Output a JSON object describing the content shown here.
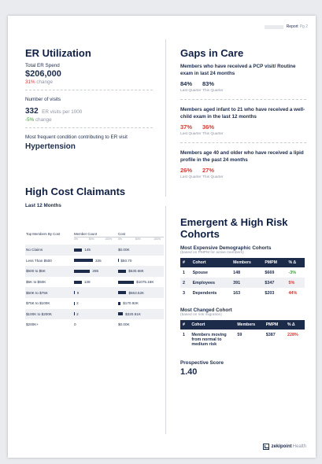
{
  "header": {
    "blurred": "",
    "report_label": "Report",
    "page_label": "Pg 2"
  },
  "er": {
    "title": "ER Utilization",
    "total_label": "Total ER Spend",
    "total_value": "$206,000",
    "total_change_value": "31%",
    "total_change_word": "change",
    "visits_label": "Number of visits",
    "visits_value": "332",
    "visits_unit": "ER visits per 1000",
    "visits_change_value": "-5%",
    "visits_change_word": "change",
    "condition_label": "Most frequent condition contributing to ER visit",
    "condition_value": "Hypertension"
  },
  "hc": {
    "title": "High Cost Claimants",
    "subtitle": "Last 12 Months",
    "col1": "Top Members By Cost",
    "col2": "Member Count",
    "col3": "Cost",
    "axis": [
      "0%",
      "50%",
      "100%"
    ],
    "rows": [
      {
        "label": "No Claims",
        "count": "145",
        "count_frac": 0.43,
        "cost": "$0.00K",
        "cost_frac": 0.0
      },
      {
        "label": "Less Than $500",
        "count": "335",
        "count_frac": 1.0,
        "cost": "$50.70",
        "cost_frac": 0.01
      },
      {
        "label": "$500 to $5K",
        "count": "285",
        "count_frac": 0.85,
        "cost": "$530.68K",
        "cost_frac": 0.28
      },
      {
        "label": "$5K to $50K",
        "count": "138",
        "count_frac": 0.41,
        "cost": "$1075.16K",
        "cost_frac": 0.56
      },
      {
        "label": "$50K to $75K",
        "count": "9",
        "count_frac": 0.03,
        "cost": "$553.52K",
        "cost_frac": 0.29
      },
      {
        "label": "$75K to $100K",
        "count": "2",
        "count_frac": 0.006,
        "cost": "$170.92K",
        "cost_frac": 0.09
      },
      {
        "label": "$100K to $200K",
        "count": "2",
        "count_frac": 0.006,
        "cost": "$320.91K",
        "cost_frac": 0.17
      },
      {
        "label": "$200K+",
        "count": "0",
        "count_frac": 0.0,
        "cost": "$0.00K",
        "cost_frac": 0.0
      }
    ]
  },
  "gaps": {
    "title": "Gaps in Care",
    "items": [
      {
        "text": "Members who have received a PCP visit/ Routine exam in last 24 months",
        "last": "84%",
        "this": "83%",
        "color": "#1d2b4a"
      },
      {
        "text": "Members aged infant to 21 who have received a well-child exam in the last 12 months",
        "last": "37%",
        "this": "36%",
        "color": "#d9362e"
      },
      {
        "text": "Members age 40 and older who have received a lipid profile in the past 24 months",
        "last": "26%",
        "this": "27%",
        "color": "#d9362e"
      }
    ],
    "last_label": "Last Quarter",
    "this_label": "This Quarter"
  },
  "emergent": {
    "title_line1": "Emergent & High Risk",
    "title_line2": "Cohorts",
    "expensive_title": "Most Expensive Demographic Cohorts",
    "expensive_sub": "(based on PMPM for active members)",
    "headers": [
      "#",
      "Cohort",
      "Members",
      "PMPM",
      "% Δ"
    ],
    "expensive_rows": [
      {
        "n": "1",
        "cohort": "Spouse",
        "members": "148",
        "pmpm": "$669",
        "pct": "-3%",
        "pct_color": "#3c9a3c"
      },
      {
        "n": "2",
        "cohort": "Employees",
        "members": "391",
        "pmpm": "$347",
        "pct": "5%",
        "pct_color": "#d9362e"
      },
      {
        "n": "3",
        "cohort": "Dependents",
        "members": "163",
        "pmpm": "$203",
        "pct": "44%",
        "pct_color": "#d9362e"
      }
    ],
    "changed_title": "Most Changed Cohort",
    "changed_sub": "(based on risk migration)",
    "changed_rows": [
      {
        "n": "1",
        "cohort": "Members moving from normal to medium risk",
        "members": "59",
        "pmpm": "$387",
        "pct": "228%",
        "pct_color": "#d9362e"
      }
    ],
    "prospective_label": "Prospective Score",
    "prospective_value": "1.40"
  },
  "footer": {
    "logo_text_bold": "zekipoint",
    "logo_text": "Health"
  }
}
